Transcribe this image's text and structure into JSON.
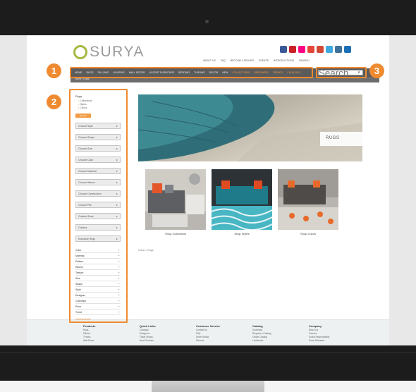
{
  "brand": {
    "name": "SURYA",
    "ring_color": "#a6b840"
  },
  "social_icons": [
    {
      "name": "facebook-icon",
      "color": "#3b5998"
    },
    {
      "name": "pinterest-icon",
      "color": "#cb2027"
    },
    {
      "name": "flickr-icon",
      "color": "#ff0084"
    },
    {
      "name": "youtube-icon",
      "color": "#e5453b"
    },
    {
      "name": "google-plus-icon",
      "color": "#d34836"
    },
    {
      "name": "twitter-icon",
      "color": "#3fa9e0"
    },
    {
      "name": "instagram-icon",
      "color": "#3f729b"
    },
    {
      "name": "linkedin-icon",
      "color": "#1c6fb5"
    }
  ],
  "top_links": [
    "About Us",
    "FAQ",
    "Become a Dealer",
    "Events",
    "Introductions",
    "Search"
  ],
  "nav": {
    "items": [
      "Home",
      "Rugs",
      "Pillows",
      "Lighting",
      "Wall Decor",
      "Accent Furniture",
      "Bedding",
      "Throws",
      "Decor",
      "New",
      "Collections",
      "Designers",
      "Trends",
      "Catalogs"
    ],
    "highlighted": [
      10,
      11,
      12,
      13
    ],
    "search_placeholder": "Search"
  },
  "breadcrumb_bar": "Home  |  Rugs",
  "callouts": [
    "1",
    "2",
    "3"
  ],
  "sidebar": {
    "title": "Rugs",
    "subitems": [
      "Collections",
      "Styles",
      "Colors"
    ],
    "search_label": "Search",
    "selects": [
      "Choose Style",
      "Choose Shape",
      "Choose Size",
      "Choose Color",
      "Choose Material",
      "Choose Weave",
      "Choose Construction",
      "Choose Pile",
      "Custom Sizes",
      "Outdoor",
      "Exclusive Rugs"
    ],
    "filters": [
      "Color",
      "Material",
      "Pattern",
      "Weave",
      "Texture",
      "Size",
      "Shape",
      "Style",
      "Designer",
      "Collection",
      "Price",
      "Trend"
    ],
    "apply_label": "Apply"
  },
  "hero": {
    "label": "RUGS"
  },
  "tiles": [
    {
      "caption": "Shop Collections"
    },
    {
      "caption": "Shop Styles"
    },
    {
      "caption": "Shop Colors"
    }
  ],
  "content_breadcrumb": "Home > Rugs",
  "footer": [
    {
      "heading": "Products",
      "items": [
        "Rugs",
        "Pillows",
        "Throws",
        "Wall Decor"
      ]
    },
    {
      "heading": "Quick Links",
      "items": [
        "Catalogs",
        "Designers",
        "Trade Shows",
        "New Products"
      ]
    },
    {
      "heading": "Customer Service",
      "items": [
        "Contact Us",
        "FAQ",
        "Order Status",
        "Returns"
      ]
    },
    {
      "heading": "Catalog",
      "items": [
        "Download",
        "Request a Catalog",
        "Online Catalog",
        "Lookbooks"
      ]
    },
    {
      "heading": "Company",
      "items": [
        "About Us",
        "Careers",
        "Social Responsibility",
        "Press Releases"
      ]
    }
  ]
}
